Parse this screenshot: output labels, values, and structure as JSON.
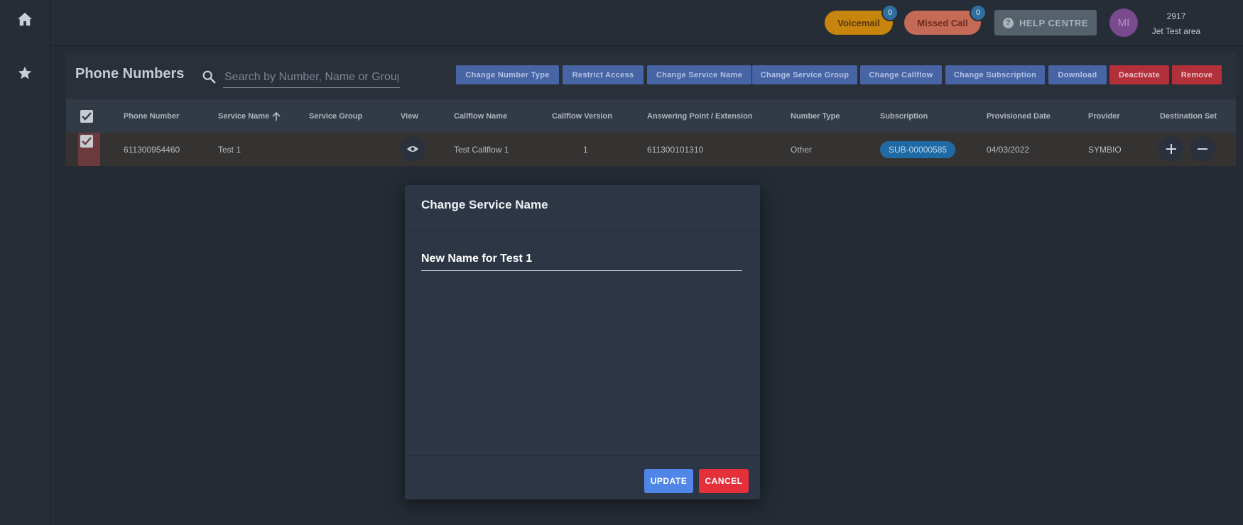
{
  "topbar": {
    "voicemail": {
      "label": "Voicemail",
      "count": "0"
    },
    "missed_call": {
      "label": "Missed Call",
      "count": "0"
    },
    "help": {
      "label": "HELP CENTRE",
      "icon": "question-circle-icon"
    },
    "avatar": {
      "initials": "MI"
    },
    "account": {
      "number": "2917",
      "area": "Jet Test area"
    }
  },
  "sidebar": {
    "items": [
      {
        "icon": "home-icon"
      },
      {
        "icon": "star-icon"
      }
    ]
  },
  "panel": {
    "title": "Phone Numbers",
    "search": {
      "placeholder": "Search by Number, Name or Group",
      "value": ""
    },
    "toolbar": [
      {
        "label": "Change Number Type",
        "style": "blue"
      },
      {
        "label": "Restrict Access",
        "style": "blue"
      },
      {
        "label": "Change Service Name",
        "style": "blue"
      },
      {
        "label": "Change Service Group",
        "style": "blue"
      },
      {
        "label": "Change Callflow",
        "style": "blue"
      },
      {
        "label": "Change Subscription",
        "style": "blue"
      },
      {
        "label": "Download",
        "style": "blue"
      },
      {
        "label": "Deactivate",
        "style": "red"
      },
      {
        "label": "Remove",
        "style": "red"
      }
    ]
  },
  "table": {
    "columns": [
      "Phone Number",
      "Service Name",
      "Service Group",
      "View",
      "Callflow Name",
      "Callflow Version",
      "Answering Point / Extension",
      "Number Type",
      "Subscription",
      "Provisioned Date",
      "Provider",
      "Destination Set"
    ],
    "sorted_column": "Service Name",
    "rows": [
      {
        "selected": true,
        "phone_number": "611300954460",
        "service_name": "Test 1",
        "service_group": "",
        "callflow_name": "Test Callflow 1",
        "callflow_version": "1",
        "answering_point": "611300101310",
        "number_type": "Other",
        "subscription": "SUB-00000585",
        "provisioned_date": "04/03/2022",
        "provider": "SYMBIO"
      }
    ]
  },
  "modal": {
    "title": "Change Service Name",
    "input_placeholder": "New Name for Test 1",
    "input_value": "",
    "update_label": "UPDATE",
    "cancel_label": "CANCEL"
  },
  "colors": {
    "accent": "#4f86e8",
    "danger": "#e5303b",
    "background": "#252c36"
  }
}
